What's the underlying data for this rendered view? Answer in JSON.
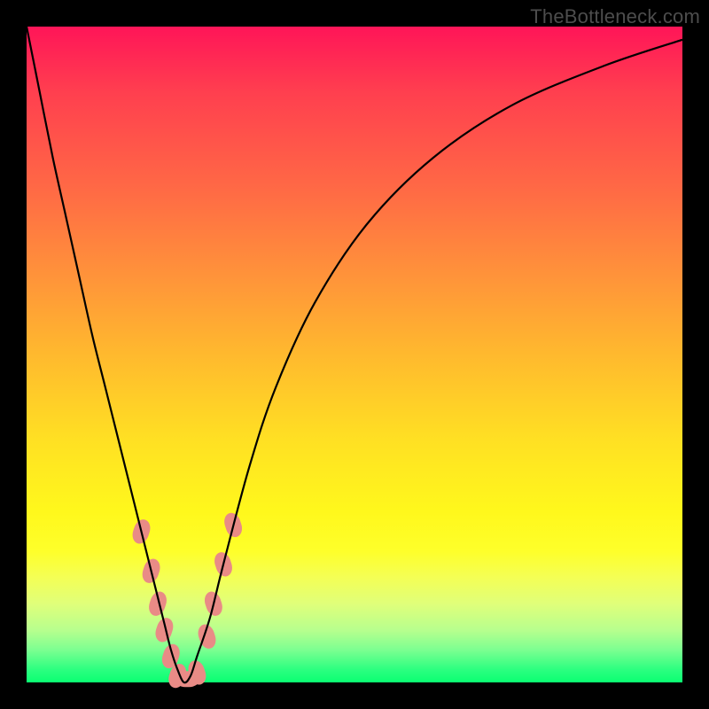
{
  "watermark": "TheBottleneck.com",
  "chart_data": {
    "type": "line",
    "title": "",
    "xlabel": "",
    "ylabel": "",
    "xlim": [
      0,
      100
    ],
    "ylim": [
      0,
      100
    ],
    "background_gradient": {
      "top_color": "#ff1558",
      "mid_colors": [
        "#ff933a",
        "#ffe023"
      ],
      "bottom_color": "#0aff72",
      "meaning": "red = high bottleneck, green = low bottleneck"
    },
    "series": [
      {
        "name": "bottleneck-curve",
        "color": "#000000",
        "x": [
          0,
          2,
          4,
          6,
          8,
          10,
          12,
          14,
          16,
          18,
          20,
          21,
          22,
          23,
          24,
          25,
          26,
          28,
          30,
          34,
          38,
          44,
          52,
          62,
          74,
          88,
          100
        ],
        "y": [
          100,
          90,
          80,
          71,
          62,
          53,
          45,
          37,
          29,
          21,
          13,
          9,
          5,
          2,
          0,
          1,
          4,
          10,
          18,
          33,
          45,
          58,
          70,
          80,
          88,
          94,
          98
        ]
      }
    ],
    "markers": [
      {
        "name": "highlight-left-branch",
        "color": "#e98b86",
        "shape": "rounded-rect",
        "points": [
          {
            "x": 17.5,
            "y": 23
          },
          {
            "x": 19.0,
            "y": 17
          },
          {
            "x": 20.0,
            "y": 12
          },
          {
            "x": 21.0,
            "y": 8
          },
          {
            "x": 22.0,
            "y": 4
          }
        ]
      },
      {
        "name": "highlight-bottom",
        "color": "#e98b86",
        "shape": "rounded-rect",
        "points": [
          {
            "x": 23.0,
            "y": 1
          },
          {
            "x": 24.5,
            "y": 0.5
          },
          {
            "x": 26.0,
            "y": 1.5
          }
        ]
      },
      {
        "name": "highlight-right-branch",
        "color": "#e98b86",
        "shape": "rounded-rect",
        "points": [
          {
            "x": 27.5,
            "y": 7
          },
          {
            "x": 28.5,
            "y": 12
          },
          {
            "x": 30.0,
            "y": 18
          },
          {
            "x": 31.5,
            "y": 24
          }
        ]
      }
    ],
    "curve_minimum": {
      "x": 24,
      "y": 0
    }
  }
}
